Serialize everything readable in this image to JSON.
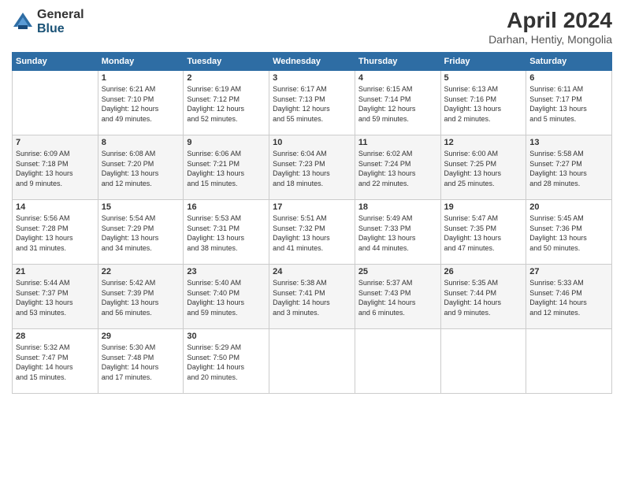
{
  "logo": {
    "general": "General",
    "blue": "Blue"
  },
  "title": {
    "month_year": "April 2024",
    "location": "Darhan, Hentiy, Mongolia"
  },
  "days_of_week": [
    "Sunday",
    "Monday",
    "Tuesday",
    "Wednesday",
    "Thursday",
    "Friday",
    "Saturday"
  ],
  "weeks": [
    [
      {
        "day": "",
        "info": ""
      },
      {
        "day": "1",
        "info": "Sunrise: 6:21 AM\nSunset: 7:10 PM\nDaylight: 12 hours\nand 49 minutes."
      },
      {
        "day": "2",
        "info": "Sunrise: 6:19 AM\nSunset: 7:12 PM\nDaylight: 12 hours\nand 52 minutes."
      },
      {
        "day": "3",
        "info": "Sunrise: 6:17 AM\nSunset: 7:13 PM\nDaylight: 12 hours\nand 55 minutes."
      },
      {
        "day": "4",
        "info": "Sunrise: 6:15 AM\nSunset: 7:14 PM\nDaylight: 12 hours\nand 59 minutes."
      },
      {
        "day": "5",
        "info": "Sunrise: 6:13 AM\nSunset: 7:16 PM\nDaylight: 13 hours\nand 2 minutes."
      },
      {
        "day": "6",
        "info": "Sunrise: 6:11 AM\nSunset: 7:17 PM\nDaylight: 13 hours\nand 5 minutes."
      }
    ],
    [
      {
        "day": "7",
        "info": "Sunrise: 6:09 AM\nSunset: 7:18 PM\nDaylight: 13 hours\nand 9 minutes."
      },
      {
        "day": "8",
        "info": "Sunrise: 6:08 AM\nSunset: 7:20 PM\nDaylight: 13 hours\nand 12 minutes."
      },
      {
        "day": "9",
        "info": "Sunrise: 6:06 AM\nSunset: 7:21 PM\nDaylight: 13 hours\nand 15 minutes."
      },
      {
        "day": "10",
        "info": "Sunrise: 6:04 AM\nSunset: 7:23 PM\nDaylight: 13 hours\nand 18 minutes."
      },
      {
        "day": "11",
        "info": "Sunrise: 6:02 AM\nSunset: 7:24 PM\nDaylight: 13 hours\nand 22 minutes."
      },
      {
        "day": "12",
        "info": "Sunrise: 6:00 AM\nSunset: 7:25 PM\nDaylight: 13 hours\nand 25 minutes."
      },
      {
        "day": "13",
        "info": "Sunrise: 5:58 AM\nSunset: 7:27 PM\nDaylight: 13 hours\nand 28 minutes."
      }
    ],
    [
      {
        "day": "14",
        "info": "Sunrise: 5:56 AM\nSunset: 7:28 PM\nDaylight: 13 hours\nand 31 minutes."
      },
      {
        "day": "15",
        "info": "Sunrise: 5:54 AM\nSunset: 7:29 PM\nDaylight: 13 hours\nand 34 minutes."
      },
      {
        "day": "16",
        "info": "Sunrise: 5:53 AM\nSunset: 7:31 PM\nDaylight: 13 hours\nand 38 minutes."
      },
      {
        "day": "17",
        "info": "Sunrise: 5:51 AM\nSunset: 7:32 PM\nDaylight: 13 hours\nand 41 minutes."
      },
      {
        "day": "18",
        "info": "Sunrise: 5:49 AM\nSunset: 7:33 PM\nDaylight: 13 hours\nand 44 minutes."
      },
      {
        "day": "19",
        "info": "Sunrise: 5:47 AM\nSunset: 7:35 PM\nDaylight: 13 hours\nand 47 minutes."
      },
      {
        "day": "20",
        "info": "Sunrise: 5:45 AM\nSunset: 7:36 PM\nDaylight: 13 hours\nand 50 minutes."
      }
    ],
    [
      {
        "day": "21",
        "info": "Sunrise: 5:44 AM\nSunset: 7:37 PM\nDaylight: 13 hours\nand 53 minutes."
      },
      {
        "day": "22",
        "info": "Sunrise: 5:42 AM\nSunset: 7:39 PM\nDaylight: 13 hours\nand 56 minutes."
      },
      {
        "day": "23",
        "info": "Sunrise: 5:40 AM\nSunset: 7:40 PM\nDaylight: 13 hours\nand 59 minutes."
      },
      {
        "day": "24",
        "info": "Sunrise: 5:38 AM\nSunset: 7:41 PM\nDaylight: 14 hours\nand 3 minutes."
      },
      {
        "day": "25",
        "info": "Sunrise: 5:37 AM\nSunset: 7:43 PM\nDaylight: 14 hours\nand 6 minutes."
      },
      {
        "day": "26",
        "info": "Sunrise: 5:35 AM\nSunset: 7:44 PM\nDaylight: 14 hours\nand 9 minutes."
      },
      {
        "day": "27",
        "info": "Sunrise: 5:33 AM\nSunset: 7:46 PM\nDaylight: 14 hours\nand 12 minutes."
      }
    ],
    [
      {
        "day": "28",
        "info": "Sunrise: 5:32 AM\nSunset: 7:47 PM\nDaylight: 14 hours\nand 15 minutes."
      },
      {
        "day": "29",
        "info": "Sunrise: 5:30 AM\nSunset: 7:48 PM\nDaylight: 14 hours\nand 17 minutes."
      },
      {
        "day": "30",
        "info": "Sunrise: 5:29 AM\nSunset: 7:50 PM\nDaylight: 14 hours\nand 20 minutes."
      },
      {
        "day": "",
        "info": ""
      },
      {
        "day": "",
        "info": ""
      },
      {
        "day": "",
        "info": ""
      },
      {
        "day": "",
        "info": ""
      }
    ]
  ]
}
